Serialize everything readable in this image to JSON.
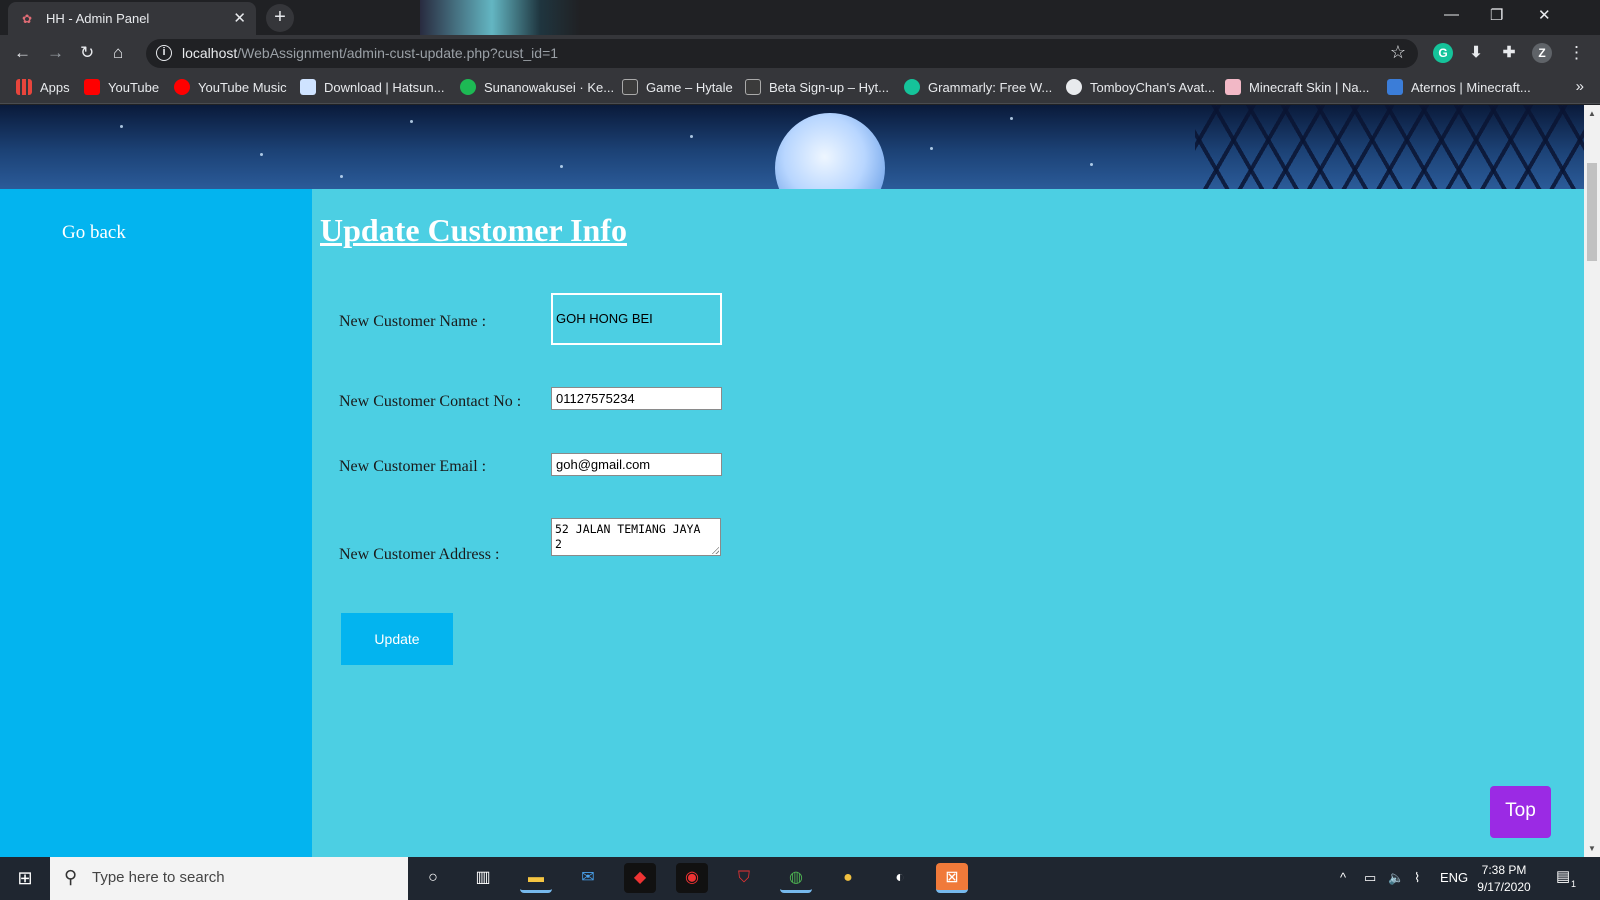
{
  "browser": {
    "tab_title": "HH - Admin Panel",
    "url_host": "localhost",
    "url_path": "/WebAssignment/admin-cust-update.php?cust_id=1",
    "profile_initial": "Z"
  },
  "bookmarks": [
    {
      "label": "Apps",
      "icon": "apps-grid-icon",
      "color": "#e8453c"
    },
    {
      "label": "YouTube",
      "icon": "youtube-icon",
      "color": "#ff0000"
    },
    {
      "label": "YouTube Music",
      "icon": "youtube-music-icon",
      "color": "#ff0000"
    },
    {
      "label": "Download | Hatsun...",
      "icon": "page-icon",
      "color": "#cfe3ff"
    },
    {
      "label": "Sunanowakusei · Ke...",
      "icon": "spotify-icon",
      "color": "#1db954"
    },
    {
      "label": "Game – Hytale",
      "icon": "hytale-icon",
      "color": "#3b3b3b"
    },
    {
      "label": "Beta Sign-up – Hyt...",
      "icon": "hytale-icon",
      "color": "#3b3b3b"
    },
    {
      "label": "Grammarly: Free W...",
      "icon": "grammarly-icon",
      "color": "#15c39a"
    },
    {
      "label": "TomboyChan's Avat...",
      "icon": "globe-icon",
      "color": "#e8eaed"
    },
    {
      "label": "Minecraft Skin | Na...",
      "icon": "minecraft-skin-icon",
      "color": "#f2b8c6"
    },
    {
      "label": "Aternos | Minecraft...",
      "icon": "aternos-icon",
      "color": "#3b7dd8"
    }
  ],
  "sidebar": {
    "go_back": "Go back"
  },
  "form": {
    "title": "Update Customer Info",
    "name_label": "New Customer Name :",
    "name_value": "GOH HONG BEI",
    "contact_label": "New Customer Contact No :",
    "contact_value": "01127575234",
    "email_label": "New Customer Email :",
    "email_value": "goh@gmail.com",
    "address_label": "New Customer Address :",
    "address_line1": "52 JALAN TEMIANG JAYA",
    "address_line2": "2",
    "update_label": "Update"
  },
  "top_button": "Top",
  "colors": {
    "sidebar": "#03b4ef",
    "main": "#4ccfe3",
    "top_button": "#9b2ae4"
  },
  "taskbar": {
    "search_placeholder": "Type here to search",
    "language": "ENG",
    "time": "7:38 PM",
    "date": "9/17/2020",
    "notification_count": "1"
  }
}
